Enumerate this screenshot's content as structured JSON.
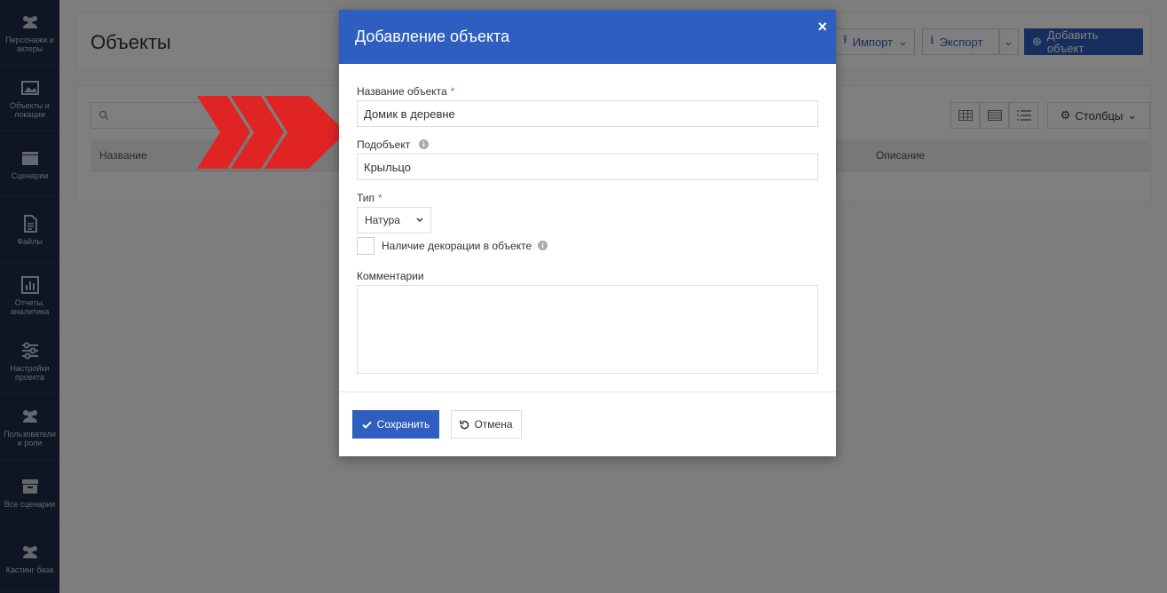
{
  "sidebar": {
    "items": [
      {
        "label": "Персонажи и актеры",
        "icon": "people-icon"
      },
      {
        "label": "Объекты и локации",
        "icon": "image-icon"
      },
      {
        "label": "Сценарии",
        "icon": "clapperboard-icon"
      },
      {
        "label": "Файлы",
        "icon": "file-icon"
      },
      {
        "label": "Отчеты, аналитика",
        "icon": "bar-chart-icon"
      },
      {
        "label": "Настройки проекта",
        "icon": "sliders-icon"
      },
      {
        "label": "Пользователи и роли",
        "icon": "users-icon"
      },
      {
        "label": "Все сценарии",
        "icon": "archive-icon"
      },
      {
        "label": "Кастинг база",
        "icon": "people-icon"
      }
    ]
  },
  "page": {
    "title": "Объекты",
    "import_label": "Импорт",
    "export_label": "Экспорт",
    "add_label": "Добавить объект",
    "columns_label": "Столбцы",
    "col_name": "Название",
    "col_desc": "Описание"
  },
  "modal": {
    "title": "Добавление объекта",
    "close": "×",
    "name_label": "Название объекта",
    "name_value": "Домик в деревне",
    "subobject_label": "Подобъект",
    "subobject_value": "Крыльцо",
    "type_label": "Тип",
    "type_value": "Натура",
    "required_mark": "*",
    "decoration_label": "Наличие декорации в объекте",
    "decoration_checked": false,
    "comments_label": "Комментарии",
    "comments_value": "",
    "save_label": "Сохранить",
    "cancel_label": "Отмена"
  },
  "colors": {
    "primary": "#2e5ebf",
    "sidebar": "#1f2a44",
    "arrow": "#e02424"
  }
}
